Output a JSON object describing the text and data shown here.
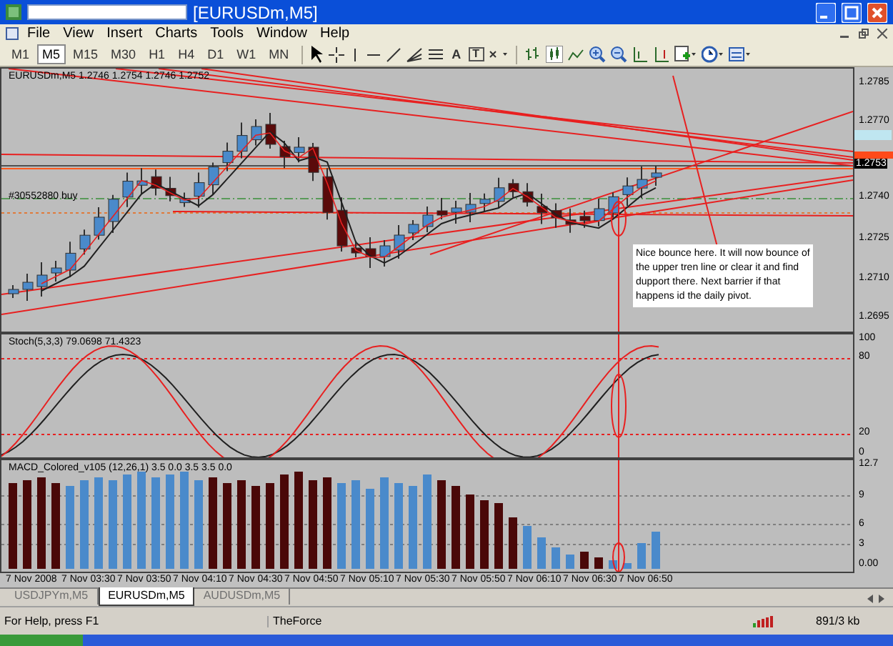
{
  "window": {
    "title": "[EURUSDm,M5]"
  },
  "menu": [
    "File",
    "View",
    "Insert",
    "Charts",
    "Tools",
    "Window",
    "Help"
  ],
  "timeframes": [
    {
      "label": "M1",
      "selected": false
    },
    {
      "label": "M5",
      "selected": true
    },
    {
      "label": "M15",
      "selected": false
    },
    {
      "label": "M30",
      "selected": false
    },
    {
      "label": "H1",
      "selected": false
    },
    {
      "label": "H4",
      "selected": false
    },
    {
      "label": "D1",
      "selected": false
    },
    {
      "label": "W1",
      "selected": false
    },
    {
      "label": "MN",
      "selected": false
    }
  ],
  "toolbar": {
    "text_tool": "A",
    "label_tool": "T"
  },
  "price_panel": {
    "label": "EURUSDm,M5  1.2746 1.2754 1.2746 1.2752",
    "order_label": "#30552880 buy",
    "ticks": [
      "1.2785",
      "1.2770",
      "1.2740",
      "1.2725",
      "1.2710",
      "1.2695"
    ],
    "current_price": "1.2753"
  },
  "annotation": "Nice bounce here. It will now bounce of the upper tren line or clear it and find dupport there. Next barrier if that happens id the daily pivot.",
  "stoch_panel": {
    "label": "Stoch(5,3,3) 79.0698 71.4323",
    "ticks": [
      "100",
      "80",
      "20",
      "0"
    ]
  },
  "macd_panel": {
    "label": "MACD_Colored_v105 (12,26,1) 3.5 0.0 3.5 3.5 0.0",
    "ticks": [
      "12.7",
      "9",
      "6",
      "3",
      "0.00"
    ]
  },
  "time_axis": [
    "7 Nov 2008",
    "7 Nov 03:30",
    "7 Nov 03:50",
    "7 Nov 04:10",
    "7 Nov 04:30",
    "7 Nov 04:50",
    "7 Nov 05:10",
    "7 Nov 05:30",
    "7 Nov 05:50",
    "7 Nov 06:10",
    "7 Nov 06:30",
    "7 Nov 06:50"
  ],
  "chart_tabs": [
    {
      "label": "USDJPYm,M5",
      "selected": false
    },
    {
      "label": "EURUSDm,M5",
      "selected": true
    },
    {
      "label": "AUDUSDm,M5",
      "selected": false
    }
  ],
  "status_bar": {
    "help": "For Help, press F1",
    "profile": "TheForce",
    "traffic": "891/3 kb"
  }
}
